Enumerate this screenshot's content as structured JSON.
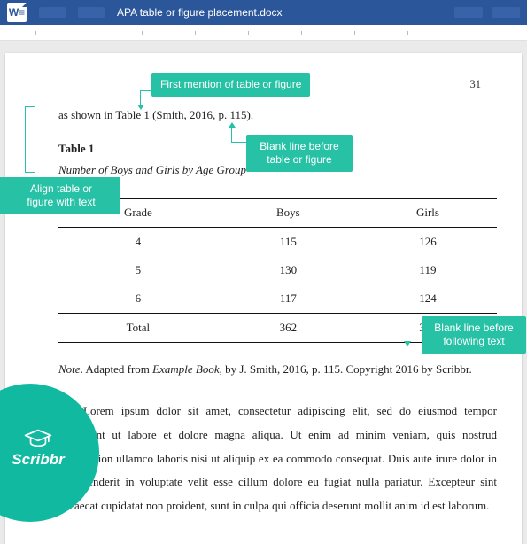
{
  "titlebar": {
    "filename": "APA table or figure placement.docx"
  },
  "doc": {
    "page_number": "31",
    "body_line": "as shown in Table 1 (Smith, 2016, p. 115).",
    "table_label": "Table 1",
    "table_title": "Number of Boys and Girls by Age Group",
    "table": {
      "headers": [
        "Grade",
        "Boys",
        "Girls"
      ],
      "rows": [
        {
          "c0": "4",
          "c1": "115",
          "c2": "126"
        },
        {
          "c0": "5",
          "c1": "130",
          "c2": "119"
        },
        {
          "c0": "6",
          "c1": "117",
          "c2": "124"
        }
      ],
      "total": {
        "c0": "Total",
        "c1": "362",
        "c2": "369"
      }
    },
    "note_label": "Note",
    "note_rest": ". Adapted from ",
    "note_book": "Example Book",
    "note_tail": ", by J. Smith, 2016, p. 115. Copyright 2016 by Scribbr.",
    "paragraph": "Lorem ipsum dolor sit amet, consectetur adipiscing elit, sed do eiusmod tempor incididunt ut labore et dolore magna aliqua. Ut enim ad minim veniam, quis nostrud exercitation ullamco laboris nisi ut aliquip ex ea commodo consequat. Duis aute irure dolor in reprehenderit in voluptate velit esse cillum dolore eu fugiat nulla pariatur. Excepteur sint occaecat cupidatat non proident, sunt in culpa qui officia deserunt mollit anim id est laborum."
  },
  "callouts": {
    "first_mention": "First mention of table or figure",
    "blank_before_l1": "Blank line before",
    "blank_before_l2": "table or figure",
    "align_l1": "Align table or",
    "align_l2": "figure with text",
    "blank_after_l1": "Blank line before",
    "blank_after_l2": "following text"
  },
  "brand": {
    "name": "Scribbr"
  },
  "colors": {
    "word_blue": "#2b579a",
    "teal": "#27c1a6",
    "badge_teal": "#12b9a1"
  },
  "chart_data": {
    "type": "table",
    "title": "Number of Boys and Girls by Age Group",
    "columns": [
      "Grade",
      "Boys",
      "Girls"
    ],
    "rows": [
      [
        "4",
        115,
        126
      ],
      [
        "5",
        130,
        119
      ],
      [
        "6",
        117,
        124
      ],
      [
        "Total",
        362,
        369
      ]
    ],
    "note": "Adapted from Example Book, by J. Smith, 2016, p. 115. Copyright 2016 by Scribbr."
  }
}
